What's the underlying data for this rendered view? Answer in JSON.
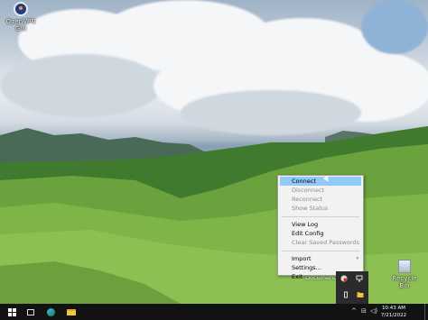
{
  "desktop": {
    "icons": [
      {
        "label": "OpenVPN GUI"
      },
      {
        "label": "Recycle Bin"
      }
    ],
    "documents_label": "Documents"
  },
  "context_menu": {
    "items": [
      {
        "label": "Connect",
        "enabled": true,
        "highlighted": true
      },
      {
        "label": "Disconnect",
        "enabled": false
      },
      {
        "label": "Reconnect",
        "enabled": false
      },
      {
        "label": "Show Status",
        "enabled": false
      },
      {
        "label": "View Log",
        "enabled": true
      },
      {
        "label": "Edit Config",
        "enabled": true
      },
      {
        "label": "Clear Saved Passwords",
        "enabled": false
      },
      {
        "label": "Import",
        "enabled": true,
        "submenu": true
      },
      {
        "label": "Settings...",
        "enabled": true
      },
      {
        "label": "Exit",
        "enabled": true
      }
    ],
    "submenu_arrow": "›"
  },
  "taskbar": {
    "clock_time": "10:43 AM",
    "clock_date": "7/21/2022",
    "icons": [
      "windows-start-icon",
      "task-view-icon",
      "edge-icon",
      "file-explorer-icon"
    ],
    "tray": {
      "overflow_chevron": "^",
      "network_glyph": "⊟",
      "volume_glyph": "◁)"
    },
    "colors": {
      "taskbar_bg": "#121212",
      "menu_highlight": "#91c9f7",
      "menu_disabled": "#8d8d8d"
    }
  }
}
